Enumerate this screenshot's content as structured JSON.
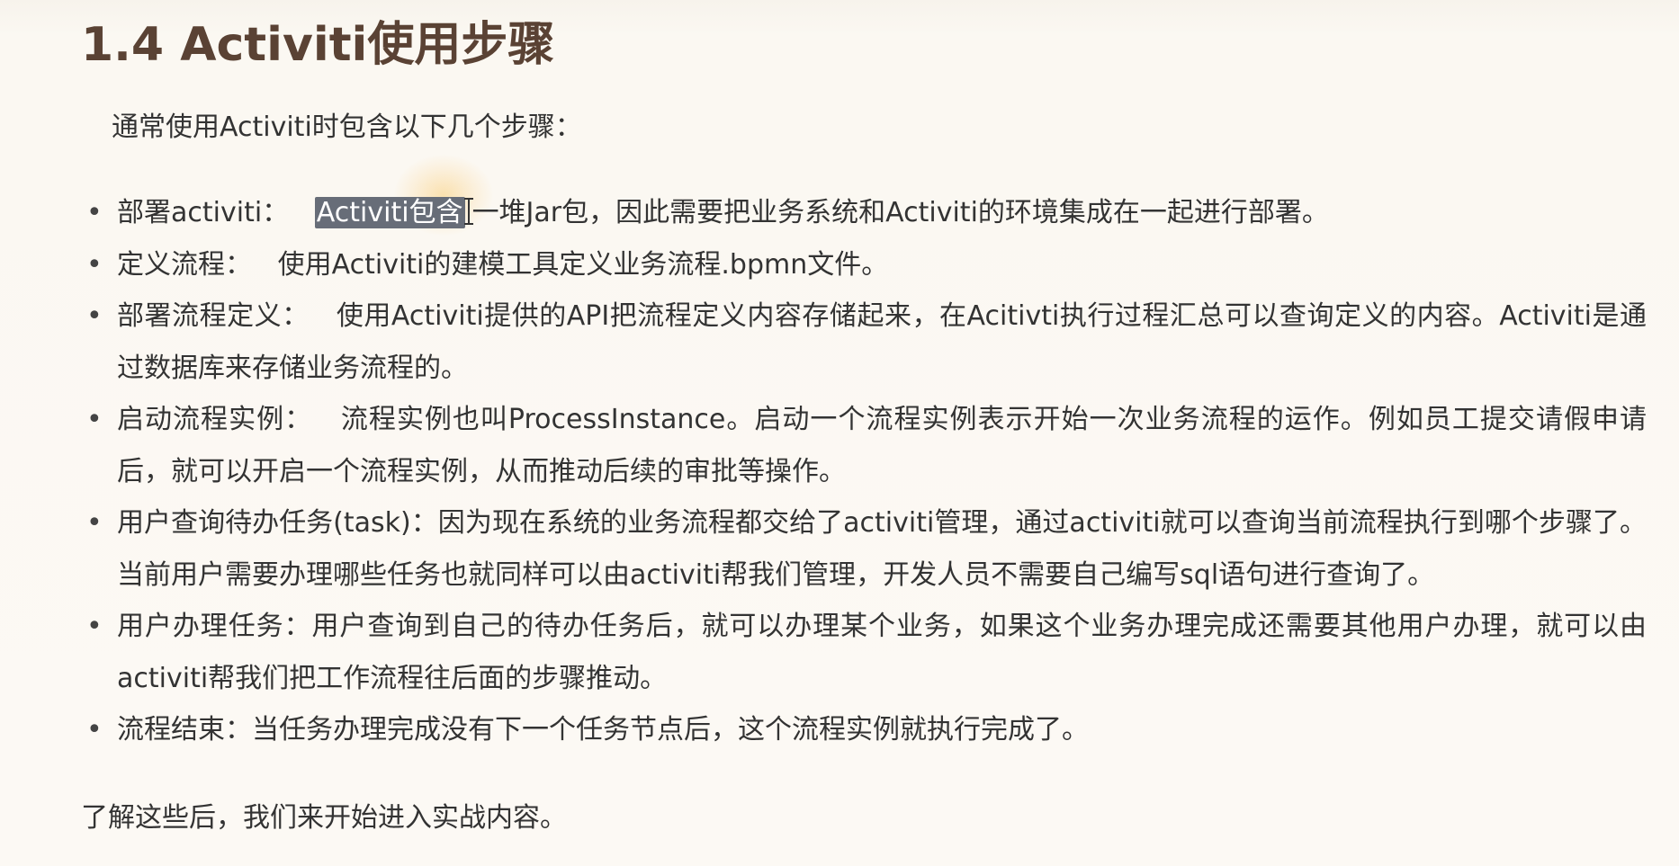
{
  "document": {
    "title": "1.4 Activiti使用步骤",
    "intro": "通常使用Activiti时包含以下几个步骤：",
    "steps": [
      {
        "label": "部署activiti：",
        "highlighted": "Activiti包含",
        "text_after_cursor": "一堆Jar包，因此需要把业务系统和Activiti的环境集成在一起进行部署。"
      },
      {
        "label": "定义流程：",
        "text": "使用Activiti的建模工具定义业务流程.bpmn文件。"
      },
      {
        "label": "部署流程定义：",
        "text": "使用Activiti提供的API把流程定义内容存储起来，在Acitivti执行过程汇总可以查询定义的内容。Activiti是通过数据库来存储业务流程的。"
      },
      {
        "label": "启动流程实例：",
        "text": "流程实例也叫ProcessInstance。启动一个流程实例表示开始一次业务流程的运作。例如员工提交请假申请后，就可以开启一个流程实例，从而推动后续的审批等操作。"
      },
      {
        "label": "用户查询待办任务(task)：",
        "text": "因为现在系统的业务流程都交给了activiti管理，通过activiti就可以查询当前流程执行到哪个步骤了。当前用户需要办理哪些任务也就同样可以由activiti帮我们管理，开发人员不需要自己编写sql语句进行查询了。"
      },
      {
        "label": "用户办理任务：",
        "text": "用户查询到自己的待办任务后，就可以办理某个业务，如果这个业务办理完成还需要其他用户办理，就可以由activiti帮我们把工作流程往后面的步骤推动。"
      },
      {
        "label": "流程结束：",
        "text": "当任务办理完成没有下一个任务节点后，这个流程实例就执行完成了。"
      }
    ],
    "bullet_char": "•",
    "closing": "了解这些后，我们来开始进入实战内容。"
  },
  "colors": {
    "background": "#fbf8f2",
    "title": "#5a4234",
    "body_text": "#333333",
    "selection_highlight": "#676d78",
    "cursor_glow": "#face78"
  },
  "icons": {
    "cursor": "text-cursor-icon"
  }
}
